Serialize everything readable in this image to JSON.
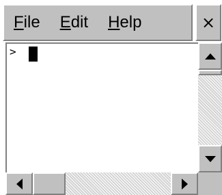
{
  "menubar": {
    "items": [
      {
        "mnemonic": "F",
        "rest": "ile"
      },
      {
        "mnemonic": "E",
        "rest": "dit"
      },
      {
        "mnemonic": "H",
        "rest": "elp"
      }
    ],
    "close_label": "×"
  },
  "console": {
    "prompt": ">"
  },
  "icons": {
    "cursor": "block-cursor-icon",
    "scroll_up": "arrow-up-icon",
    "scroll_down": "arrow-down-icon",
    "scroll_left": "arrow-left-icon",
    "scroll_right": "arrow-right-icon"
  },
  "colors": {
    "chrome": "#c0c0c0",
    "highlight": "#ffffff",
    "shadow": "#808080",
    "background": "#ffffff",
    "text": "#000000"
  }
}
